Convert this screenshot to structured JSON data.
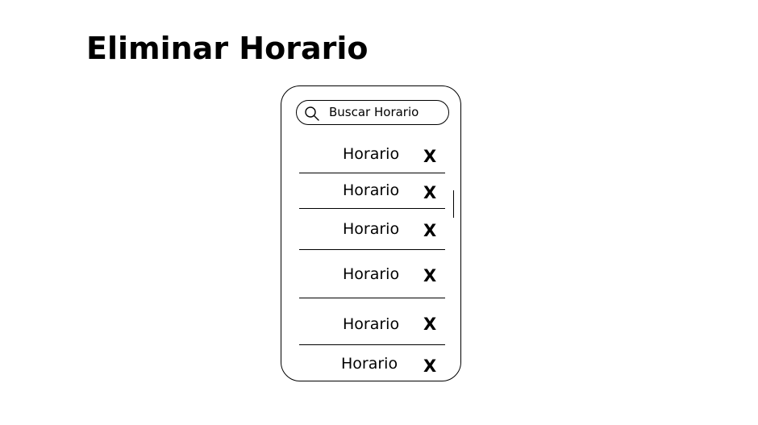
{
  "page": {
    "title": "Eliminar Horario"
  },
  "search": {
    "placeholder": "Buscar Horario",
    "icon": "search-icon"
  },
  "list": {
    "items": [
      {
        "label": "Horario",
        "delete_label": "X"
      },
      {
        "label": "Horario",
        "delete_label": "X"
      },
      {
        "label": "Horario",
        "delete_label": "X"
      },
      {
        "label": "Horario",
        "delete_label": "X"
      },
      {
        "label": "Horario",
        "delete_label": "X"
      },
      {
        "label": "Horario",
        "delete_label": "X"
      }
    ]
  },
  "colors": {
    "background": "#ffffff",
    "foreground": "#000000"
  }
}
